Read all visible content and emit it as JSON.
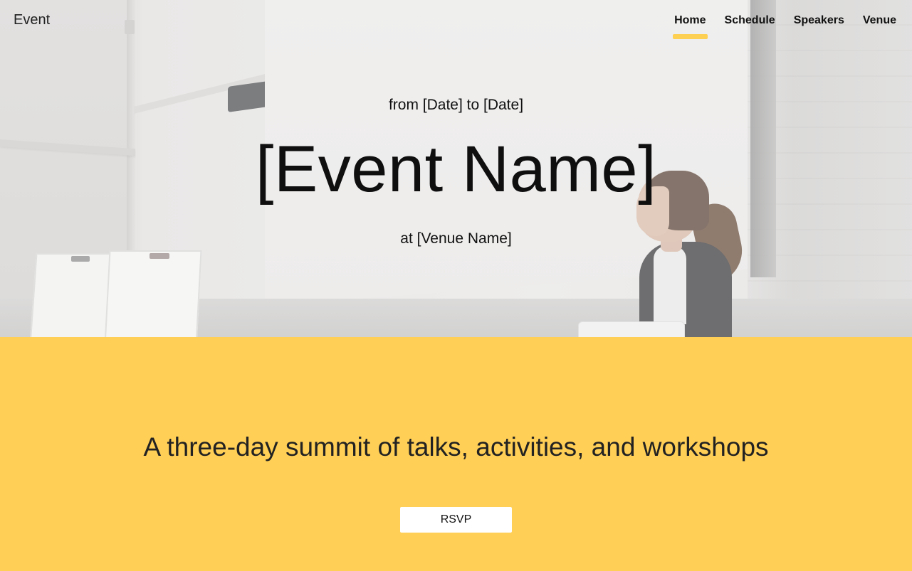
{
  "brand": {
    "label": "Event"
  },
  "nav": {
    "items": [
      {
        "label": "Home",
        "active": true
      },
      {
        "label": "Schedule",
        "active": false
      },
      {
        "label": "Speakers",
        "active": false
      },
      {
        "label": "Venue",
        "active": false
      }
    ]
  },
  "hero": {
    "date_line": "from [Date] to [Date]",
    "title": "[Event Name]",
    "venue_line": "at [Venue Name]"
  },
  "summary": {
    "text": "A three-day summit of talks, activities, and workshops",
    "button_label": "RSVP"
  },
  "colors": {
    "accent": "#ffcf56",
    "nav_underline": "#fdcf52",
    "text": "#111111"
  }
}
